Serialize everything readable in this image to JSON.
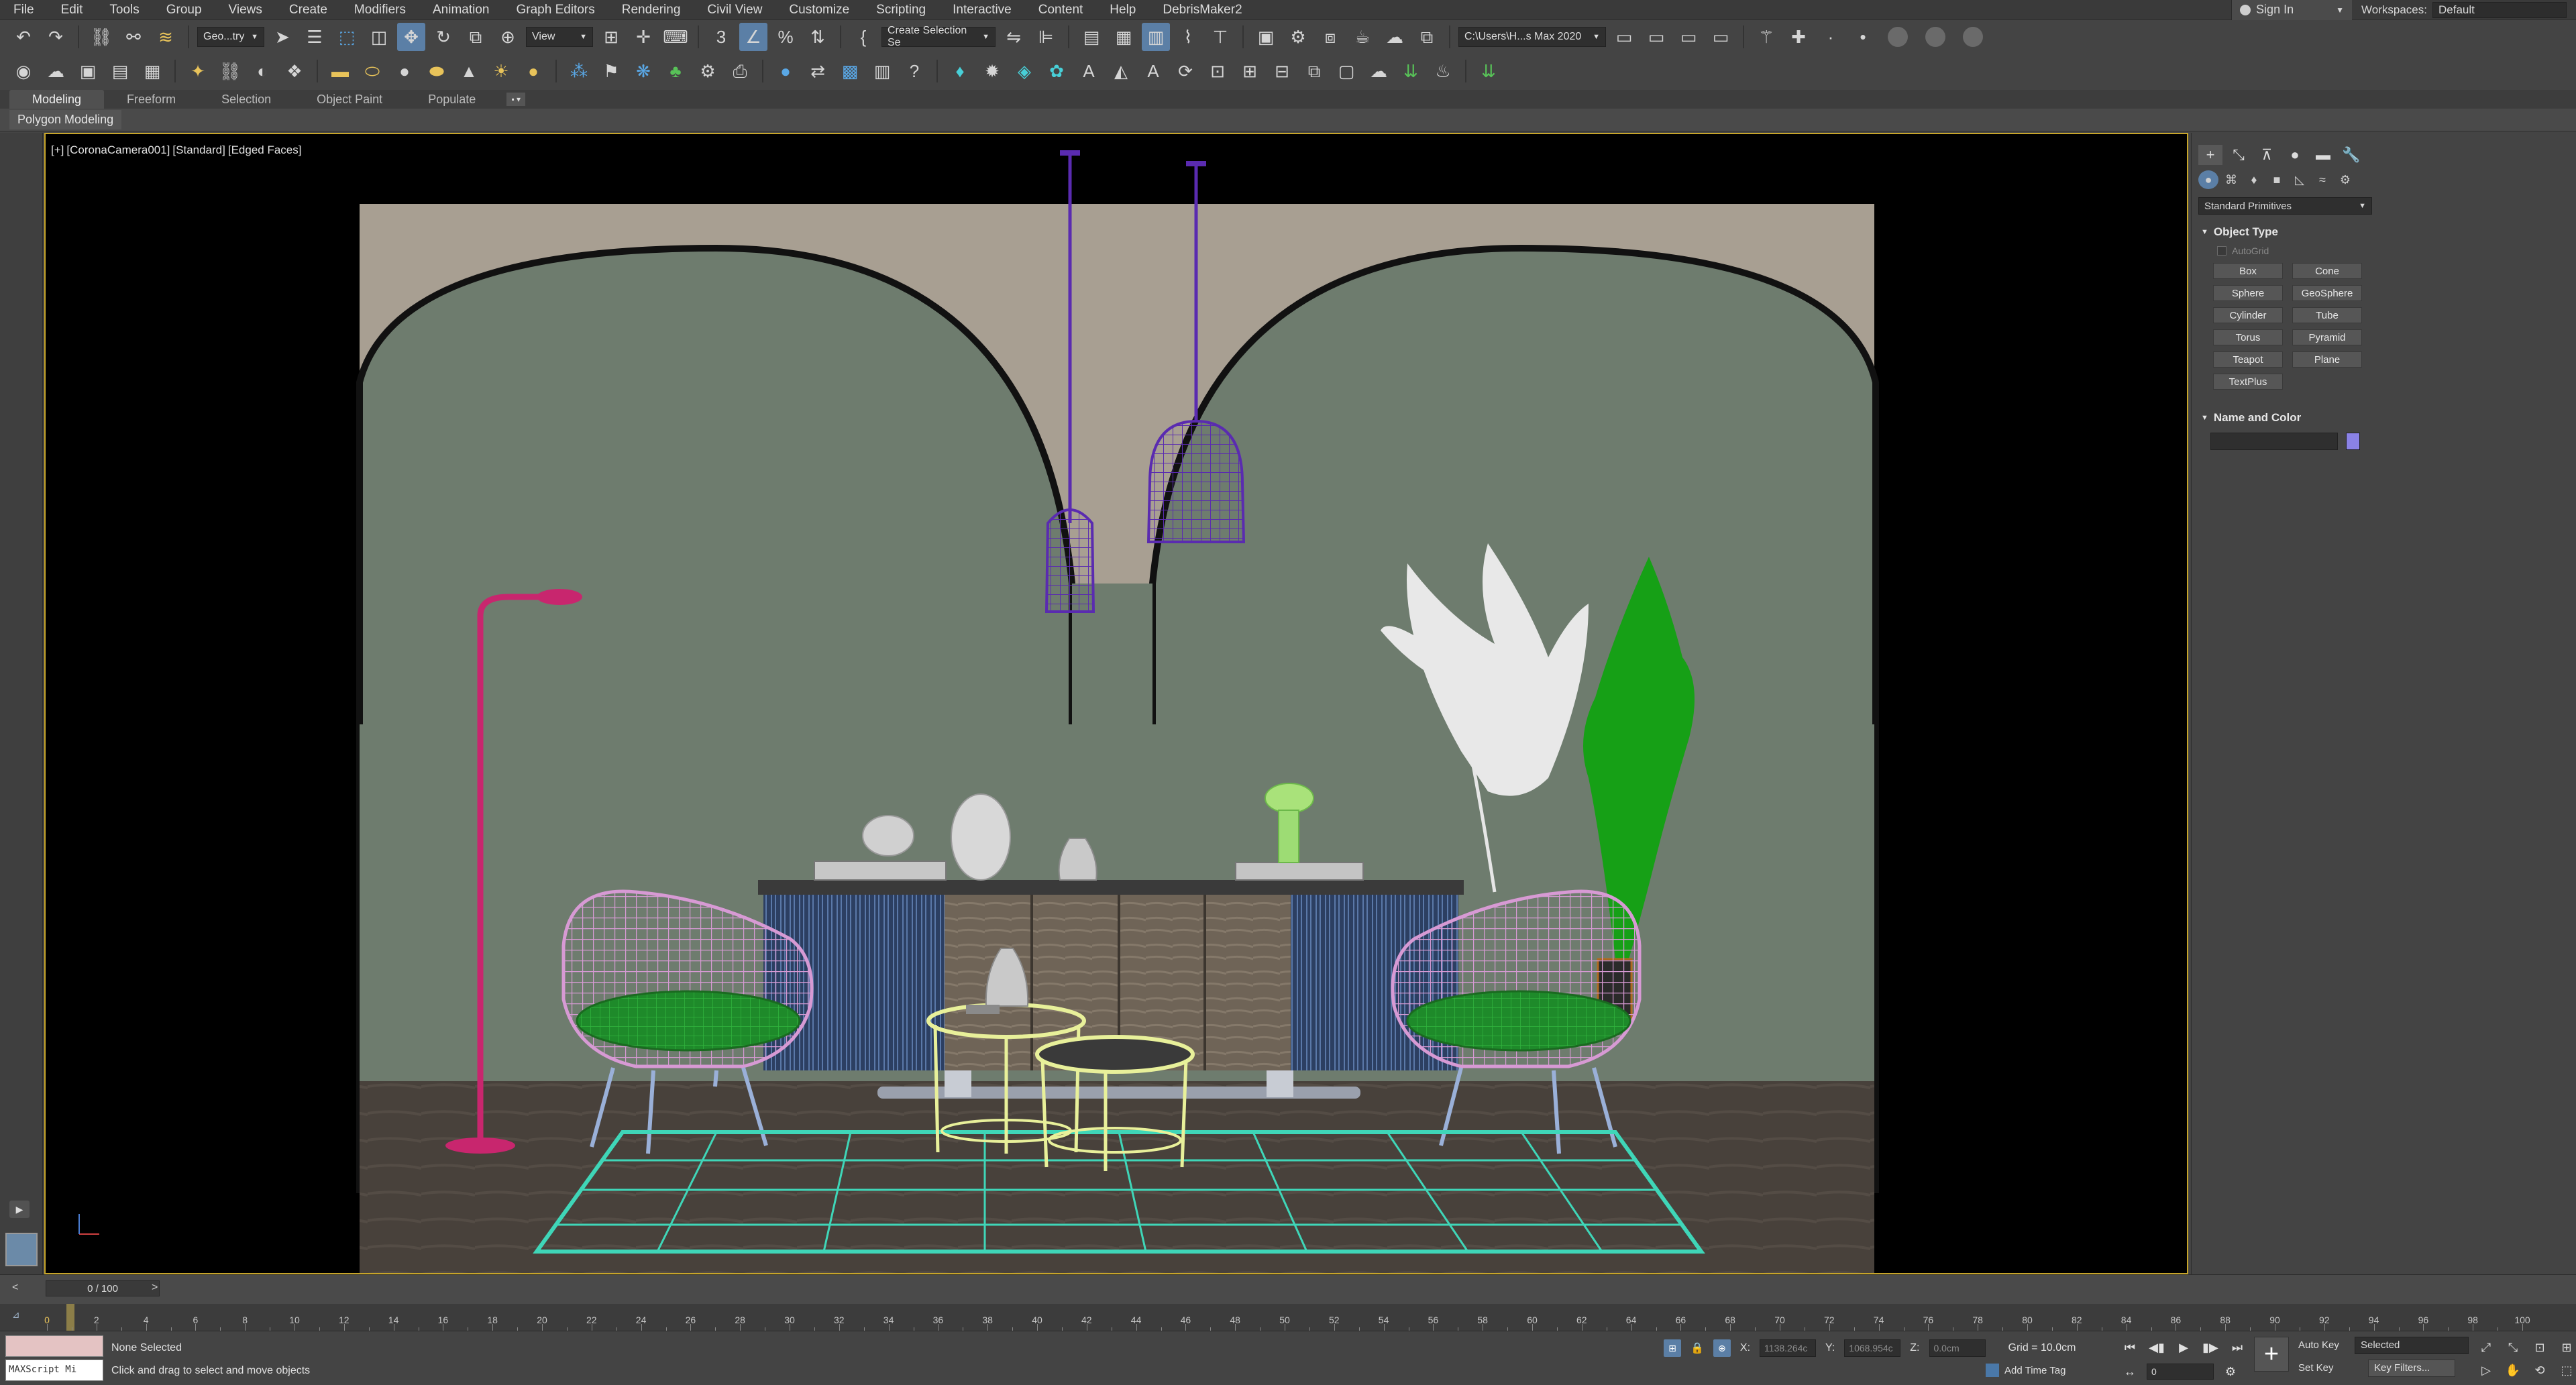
{
  "menu": [
    "File",
    "Edit",
    "Tools",
    "Group",
    "Views",
    "Create",
    "Modifiers",
    "Animation",
    "Graph Editors",
    "Rendering",
    "Civil View",
    "Customize",
    "Scripting",
    "Interactive",
    "Content",
    "Help",
    "DebrisMaker2"
  ],
  "account": {
    "signin_label": "Sign In",
    "workspaces_label": "Workspaces:",
    "workspace_value": "Default"
  },
  "toolbar1": {
    "selection_filter": "Geo...try",
    "ref_coord": "View",
    "selection_set": "Create Selection Se",
    "project_path": "C:\\Users\\H...s Max 2020"
  },
  "ribbon": {
    "tabs": [
      "Modeling",
      "Freeform",
      "Selection",
      "Object Paint",
      "Populate"
    ],
    "active_sub": "Polygon Modeling"
  },
  "viewport": {
    "label_parts": [
      "[+]",
      "[CoronaCamera001]",
      "[Standard]",
      "[Edged Faces]"
    ],
    "scene_colors": {
      "wall": "#6e7c6e",
      "arch_wall": "#a89f92",
      "floor": "#4a423c",
      "pendant": "#5a2bb0",
      "chairs": "#d79ad4",
      "cushion": "#1e8a2a",
      "tables": "#e8f09a",
      "rug": "#3fd6b8",
      "floor_lamp": "#c8266e",
      "pampas": "#e6e6e6",
      "plant": "#16a016"
    }
  },
  "command_panel": {
    "category_dropdown": "Standard Primitives",
    "object_type_title": "Object Type",
    "autogrid_label": "AutoGrid",
    "object_buttons": [
      "Box",
      "Cone",
      "Sphere",
      "GeoSphere",
      "Cylinder",
      "Tube",
      "Torus",
      "Pyramid",
      "Teapot",
      "Plane",
      "TextPlus"
    ],
    "name_color_title": "Name and Color",
    "name_value": "",
    "swatch_color": "#8a82e6"
  },
  "timeline": {
    "frame_display": "0 / 100",
    "ticks": [
      "0",
      "2",
      "4",
      "6",
      "8",
      "10",
      "12",
      "14",
      "16",
      "18",
      "20",
      "22",
      "24",
      "26",
      "28",
      "30",
      "32",
      "34",
      "36",
      "38",
      "40",
      "42",
      "44",
      "46",
      "48",
      "50",
      "52",
      "54",
      "56",
      "58",
      "60",
      "62",
      "64",
      "66",
      "68",
      "70",
      "72",
      "74",
      "76",
      "78",
      "80",
      "82",
      "84",
      "86",
      "88",
      "90",
      "92",
      "94",
      "96",
      "98",
      "100"
    ]
  },
  "status": {
    "maxscript_label": "MAXScript Mi",
    "selection_status": "None Selected",
    "prompt": "Click and drag to select and move objects",
    "x_label": "X:",
    "x_value": "1138.264c",
    "y_label": "Y:",
    "y_value": "1068.954c",
    "z_label": "Z:",
    "z_value": "0.0cm",
    "grid": "Grid = 10.0cm",
    "add_time_tag": "Add Time Tag",
    "current_frame": "0",
    "auto_key": "Auto Key",
    "set_key": "Set Key",
    "key_mode": "Selected",
    "key_filters": "Key Filters..."
  }
}
